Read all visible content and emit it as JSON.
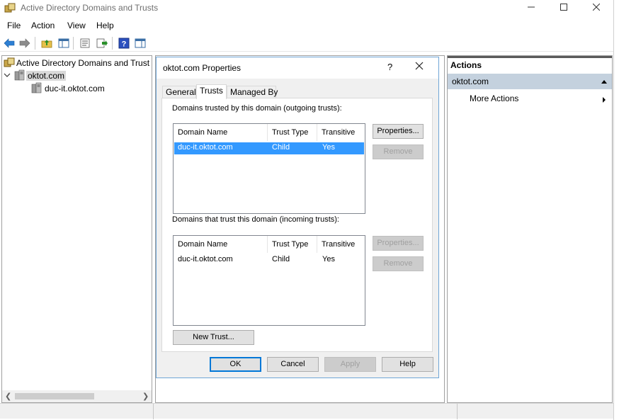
{
  "window": {
    "title": "Active Directory Domains and Trusts"
  },
  "menu": {
    "items": [
      "File",
      "Action",
      "View",
      "Help"
    ]
  },
  "tree": {
    "root_label": "Active Directory Domains and Trust",
    "domain_label": "oktot.com",
    "child_label": "duc-it.oktot.com"
  },
  "dialog": {
    "title": "oktot.com Properties",
    "help_glyph": "?",
    "tabs": [
      "General",
      "Trusts",
      "Managed By"
    ],
    "outgoing": {
      "label": "Domains trusted by this domain (outgoing trusts):",
      "columns": [
        "Domain Name",
        "Trust Type",
        "Transitive"
      ],
      "rows": [
        {
          "name": "duc-it.oktot.com",
          "type": "Child",
          "transitive": "Yes"
        }
      ],
      "properties_button": "Properties...",
      "remove_button": "Remove"
    },
    "incoming": {
      "label": "Domains that trust this domain (incoming trusts):",
      "columns": [
        "Domain Name",
        "Trust Type",
        "Transitive"
      ],
      "rows": [
        {
          "name": "duc-it.oktot.com",
          "type": "Child",
          "transitive": "Yes"
        }
      ],
      "properties_button": "Properties...",
      "remove_button": "Remove"
    },
    "new_trust_button": "New Trust...",
    "ok_button": "OK",
    "cancel_button": "Cancel",
    "apply_button": "Apply",
    "help_button": "Help"
  },
  "actions": {
    "header": "Actions",
    "section": "oktot.com",
    "more_actions": "More Actions"
  },
  "colors": {
    "selection": "#3399ff",
    "actions_section_bg": "#c4d1de",
    "default_button_border": "#0078d7"
  }
}
